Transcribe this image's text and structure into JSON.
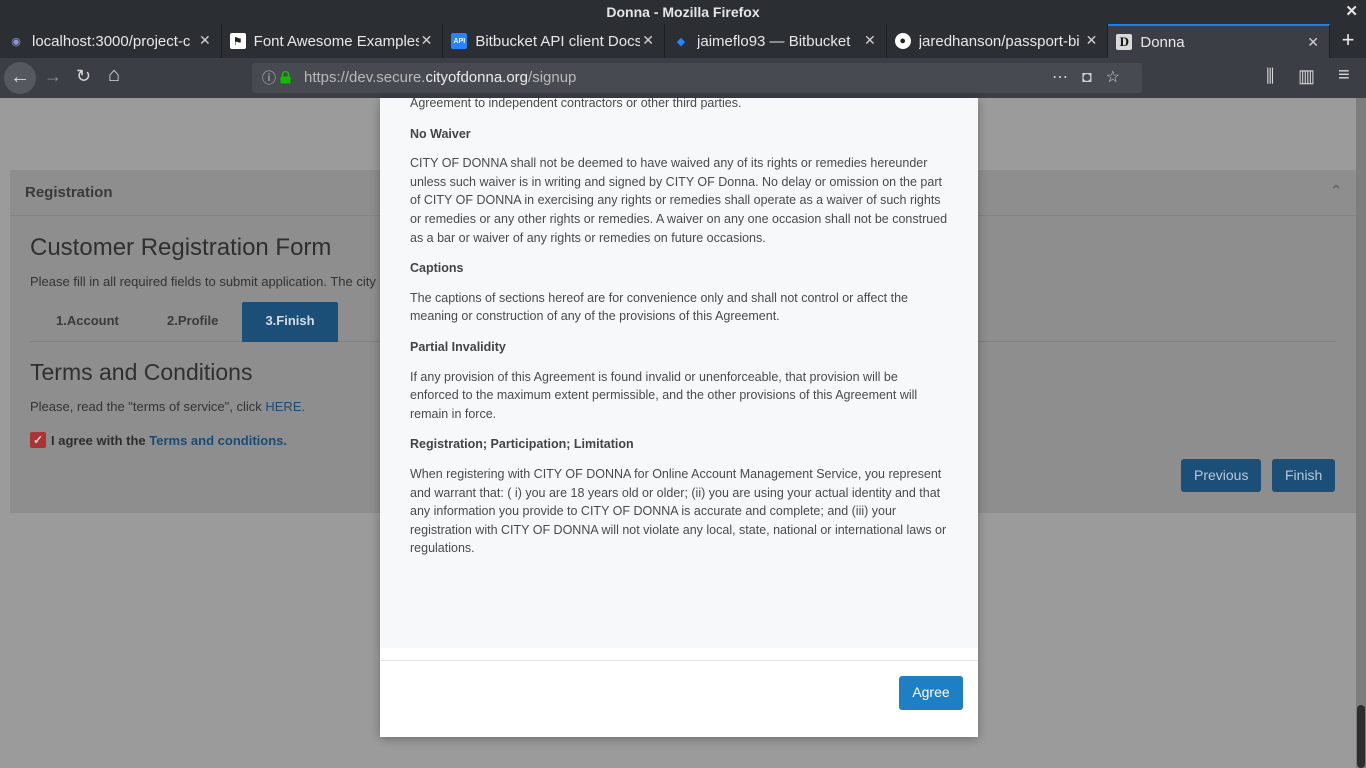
{
  "window": {
    "title": "Donna - Mozilla Firefox",
    "close_glyph": "✕"
  },
  "tabs": [
    {
      "title": "localhost:3000/project-c",
      "favicon": "◉",
      "favicon_color": "#3a3f6b"
    },
    {
      "title": "Font Awesome Examples",
      "favicon": "⚑",
      "favicon_color": "#222222"
    },
    {
      "title": "Bitbucket API client Docs",
      "favicon": "API",
      "favicon_color": "#2684ff"
    },
    {
      "title": "jaimeflo93 — Bitbucket",
      "favicon": "◆",
      "favicon_color": "#2684ff"
    },
    {
      "title": "jaredhanson/passport-bi",
      "favicon": "●",
      "favicon_color": "#333333"
    },
    {
      "title": "Donna",
      "favicon": "D",
      "favicon_color": "#3b3f45"
    }
  ],
  "tab_close_glyph": "✕",
  "new_tab_glyph": "+",
  "nav": {
    "back": "←",
    "forward": "→",
    "reload": "↻",
    "home": "⌂",
    "url_prefix": "https://dev.secure.",
    "url_host": "cityofdonna.org",
    "url_path": "/signup",
    "page_actions": "⋯",
    "pocket": "◘",
    "bookmark": "☆",
    "library": "⫼",
    "sidebar": "▥",
    "menu": "≡"
  },
  "panel": {
    "heading": "Registration",
    "chevron": "⌃",
    "form_title": "Customer Registration Form",
    "form_subtitle": "Please fill in all required fields to submit application. The city",
    "steps": [
      "1.Account",
      "2.Profile",
      "3.Finish"
    ],
    "terms_title": "Terms and Conditions",
    "terms_read_text": "Please, read the \"terms of service\", click ",
    "terms_read_link": "HERE.",
    "agree_checked": true,
    "agree_text": "I agree with the ",
    "agree_link": "Terms and conditions.",
    "previous_label": "Previous",
    "finish_label": "Finish"
  },
  "modal": {
    "intro": "Agreement to independent contractors or other third parties.",
    "sections": [
      {
        "heading": "No Waiver",
        "body": "CITY OF DONNA shall not be deemed to have waived any of its rights or remedies hereunder unless such waiver is in writing and signed by CITY OF Donna. No delay or omission on the part of CITY OF DONNA in exercising any rights or remedies shall operate as a waiver of such rights or remedies or any other rights or remedies. A waiver on any one occasion shall not be construed as a bar or waiver of any rights or remedies on future occasions."
      },
      {
        "heading": "Captions",
        "body": "The captions of sections hereof are for convenience only and shall not control or affect the meaning or construction of any of the provisions of this Agreement."
      },
      {
        "heading": "Partial Invalidity",
        "body": "If any provision of this Agreement is found invalid or unenforceable, that provision will be enforced to the maximum extent permissible, and the other provisions of this Agreement will remain in force."
      },
      {
        "heading": "Registration; Participation; Limitation",
        "body": "When registering with CITY OF DONNA for Online Account Management Service, you represent and warrant that: ( i) you are 18 years old or older; (ii) you are using your actual identity and that any information you provide to CITY OF DONNA is accurate and complete; and (iii) your registration with CITY OF DONNA will not violate any local, state, national or international laws or regulations."
      }
    ],
    "agree_label": "Agree"
  }
}
